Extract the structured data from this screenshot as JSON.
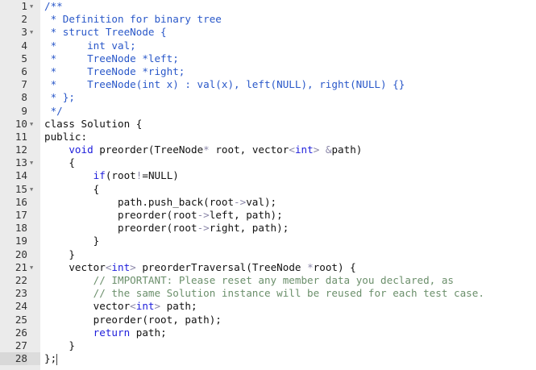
{
  "editor": {
    "active_line": 28,
    "colors": {
      "doc_comment": "#2a58c9",
      "keyword": "#1d1ddb",
      "operator": "#8a86a8",
      "line_comment": "#6b8f6b",
      "text": "#111111",
      "gutter": "#ebebeb"
    },
    "fold_icon": "triangle-down-icon",
    "lines": [
      {
        "n": "1",
        "fold": true,
        "tokens": [
          [
            "c",
            "/**"
          ]
        ]
      },
      {
        "n": "2",
        "tokens": [
          [
            "c",
            " * Definition for binary tree"
          ]
        ]
      },
      {
        "n": "3",
        "fold": true,
        "tokens": [
          [
            "c",
            " * struct TreeNode {"
          ]
        ]
      },
      {
        "n": "4",
        "tokens": [
          [
            "c",
            " *     int val;"
          ]
        ]
      },
      {
        "n": "5",
        "tokens": [
          [
            "c",
            " *     TreeNode *left;"
          ]
        ]
      },
      {
        "n": "6",
        "tokens": [
          [
            "c",
            " *     TreeNode *right;"
          ]
        ]
      },
      {
        "n": "7",
        "tokens": [
          [
            "c",
            " *     TreeNode(int x) : val(x), left(NULL), right(NULL) {}"
          ]
        ]
      },
      {
        "n": "8",
        "tokens": [
          [
            "c",
            " * };"
          ]
        ]
      },
      {
        "n": "9",
        "tokens": [
          [
            "c",
            " */"
          ]
        ]
      },
      {
        "n": "10",
        "fold": true,
        "tokens": [
          [
            "t",
            "class Solution {"
          ]
        ]
      },
      {
        "n": "11",
        "tokens": [
          [
            "t",
            "public:"
          ]
        ]
      },
      {
        "n": "12",
        "tokens": [
          [
            "t",
            "    "
          ],
          [
            "k",
            "void"
          ],
          [
            "t",
            " preorder(TreeNode"
          ],
          [
            "o",
            "*"
          ],
          [
            "t",
            " root, vector"
          ],
          [
            "o",
            "<"
          ],
          [
            "k",
            "int"
          ],
          [
            "o",
            ">"
          ],
          [
            "t",
            " "
          ],
          [
            "o",
            "&"
          ],
          [
            "t",
            "path)"
          ]
        ]
      },
      {
        "n": "13",
        "fold": true,
        "tokens": [
          [
            "t",
            "    {"
          ]
        ]
      },
      {
        "n": "14",
        "tokens": [
          [
            "t",
            "        "
          ],
          [
            "k",
            "if"
          ],
          [
            "t",
            "(root"
          ],
          [
            "o",
            "!"
          ],
          [
            "t",
            "=NULL)"
          ]
        ]
      },
      {
        "n": "15",
        "fold": true,
        "tokens": [
          [
            "t",
            "        {"
          ]
        ]
      },
      {
        "n": "16",
        "tokens": [
          [
            "t",
            "            path.push_back(root"
          ],
          [
            "o",
            "->"
          ],
          [
            "t",
            "val);"
          ]
        ]
      },
      {
        "n": "17",
        "tokens": [
          [
            "t",
            "            preorder(root"
          ],
          [
            "o",
            "->"
          ],
          [
            "t",
            "left, path);"
          ]
        ]
      },
      {
        "n": "18",
        "tokens": [
          [
            "t",
            "            preorder(root"
          ],
          [
            "o",
            "->"
          ],
          [
            "t",
            "right, path);"
          ]
        ]
      },
      {
        "n": "19",
        "tokens": [
          [
            "t",
            "        }"
          ]
        ]
      },
      {
        "n": "20",
        "tokens": [
          [
            "t",
            "    }"
          ]
        ]
      },
      {
        "n": "21",
        "fold": true,
        "tokens": [
          [
            "t",
            "    vector"
          ],
          [
            "o",
            "<"
          ],
          [
            "k",
            "int"
          ],
          [
            "o",
            ">"
          ],
          [
            "t",
            " preorderTraversal(TreeNode "
          ],
          [
            "o",
            "*"
          ],
          [
            "t",
            "root) {"
          ]
        ]
      },
      {
        "n": "22",
        "tokens": [
          [
            "t",
            "        "
          ],
          [
            "g",
            "// IMPORTANT: Please reset any member data you declared, as"
          ]
        ]
      },
      {
        "n": "23",
        "tokens": [
          [
            "t",
            "        "
          ],
          [
            "g",
            "// the same Solution instance will be reused for each test case."
          ]
        ]
      },
      {
        "n": "24",
        "tokens": [
          [
            "t",
            "        vector"
          ],
          [
            "o",
            "<"
          ],
          [
            "k",
            "int"
          ],
          [
            "o",
            ">"
          ],
          [
            "t",
            " path;"
          ]
        ]
      },
      {
        "n": "25",
        "tokens": [
          [
            "t",
            "        preorder(root, path);"
          ]
        ]
      },
      {
        "n": "26",
        "tokens": [
          [
            "t",
            "        "
          ],
          [
            "k",
            "return"
          ],
          [
            "t",
            " path;"
          ]
        ]
      },
      {
        "n": "27",
        "tokens": [
          [
            "t",
            "    }"
          ]
        ]
      },
      {
        "n": "28",
        "tokens": [
          [
            "t",
            "};"
          ]
        ]
      }
    ]
  }
}
